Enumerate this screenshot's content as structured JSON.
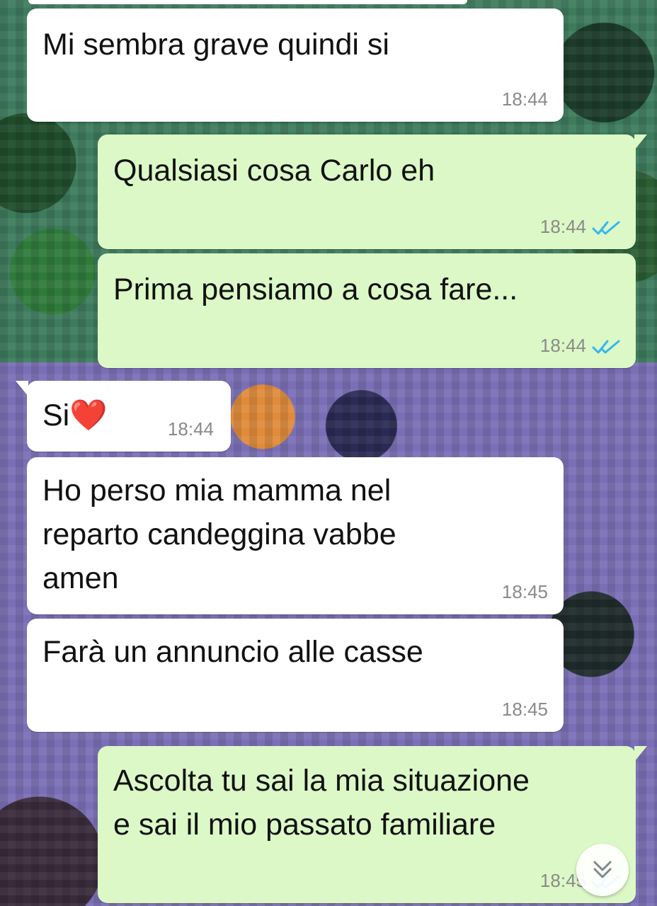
{
  "messages": [
    {
      "type": "incoming",
      "text": "Mi sembra grave quindi si",
      "time": "18:44"
    },
    {
      "type": "outgoing",
      "text": "Qualsiasi cosa Carlo eh",
      "time": "18:44",
      "status": "read"
    },
    {
      "type": "outgoing",
      "text": "Prima pensiamo a cosa fare...",
      "time": "18:44",
      "status": "read"
    },
    {
      "type": "incoming",
      "text": "Si❤️",
      "time": "18:44"
    },
    {
      "type": "incoming",
      "text": "Ho perso mia mamma nel\nreparto candeggina vabbe\namen",
      "time": "18:45"
    },
    {
      "type": "incoming",
      "text": "Farà un annuncio alle casse",
      "time": "18:45"
    },
    {
      "type": "outgoing",
      "text": "Ascolta tu sai la mia situazione\ne sai il mio passato familiare",
      "time": "18:45",
      "status": "read"
    }
  ],
  "icons": {
    "read_receipt": "double-check-icon",
    "scroll_down": "chevron-double-down-icon"
  },
  "colors": {
    "incoming_bubble": "#ffffff",
    "outgoing_bubble": "#dcf8c6",
    "read_tick": "#34b7f1",
    "timestamp": "#8a8a8a"
  }
}
